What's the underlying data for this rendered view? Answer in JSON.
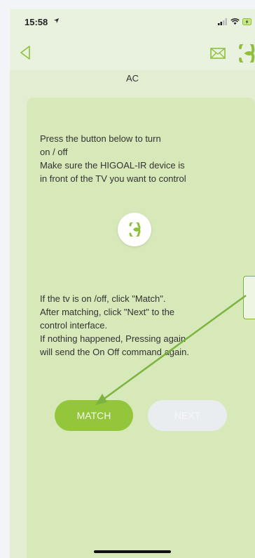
{
  "status_bar": {
    "time": "15:58",
    "icons": [
      "location-arrow-icon",
      "signal-icon",
      "wifi-icon",
      "battery-charging-icon"
    ]
  },
  "nav": {
    "icons": [
      "back-icon",
      "mail-icon",
      "app-logo-icon"
    ]
  },
  "page": {
    "title": "AC"
  },
  "instructions": {
    "top_lines": [
      "Press the button below to turn",
      "on / off",
      "Make sure the HIGOAL-IR device is",
      "in front of the TV you want to control"
    ],
    "bottom_lines": [
      "If the tv is on /off,  click \"Match\".",
      "After matching,  click \"Next\" to the",
      "control interface.",
      "If nothing happened,  Pressing again",
      "will send the On Off command again."
    ]
  },
  "buttons": {
    "match": "MATCH",
    "next": "NEXT"
  },
  "colors": {
    "accent": "#93c63b",
    "card_bg": "#d7e8b9",
    "screen_bg": "#e2edd2",
    "annotation_arrow": "#7ab43e",
    "next_disabled": "#eaedf0"
  }
}
